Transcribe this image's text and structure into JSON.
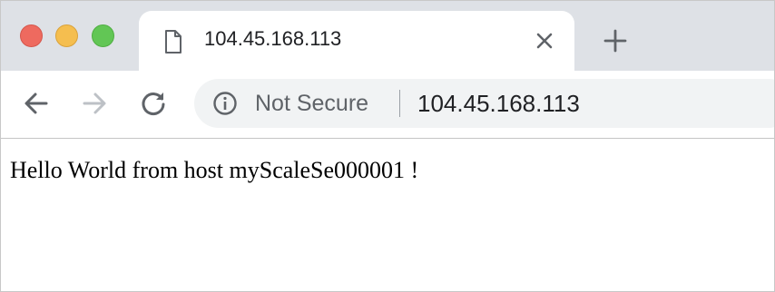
{
  "window_controls": {
    "close": "close",
    "minimize": "minimize",
    "maximize": "maximize"
  },
  "tab": {
    "title": "104.45.168.113",
    "icon": "file-icon"
  },
  "toolbar": {
    "back_icon": "arrow-left-icon",
    "forward_icon": "arrow-right-icon",
    "reload_icon": "reload-icon"
  },
  "address_bar": {
    "security_icon": "info-icon",
    "security_text": "Not Secure",
    "url": "104.45.168.113"
  },
  "page": {
    "body_text": "Hello World from host myScaleSe000001 !"
  },
  "colors": {
    "tabstrip_bg": "#dee1e6",
    "omnibox_bg": "#f1f3f4",
    "close_red": "#ee6a5f",
    "minimize_yellow": "#f5be4f",
    "maximize_green": "#62c655"
  }
}
